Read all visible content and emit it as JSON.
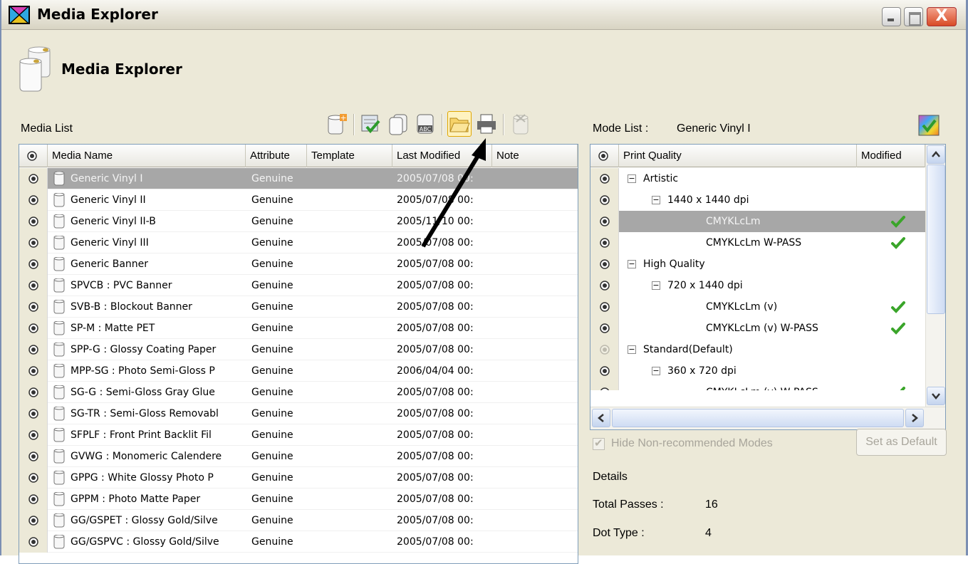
{
  "window": {
    "title": "Media Explorer",
    "close_glyph": "X"
  },
  "header": {
    "title": "Media Explorer",
    "icon": "media-rolls-icon"
  },
  "media_list": {
    "label": "Media List",
    "columns": [
      "Media Name",
      "Attribute",
      "Template",
      "Last Modified",
      "Note"
    ],
    "rows": [
      {
        "name": "Generic Vinyl I",
        "attribute": "Genuine",
        "template": "",
        "last_modified": "2005/07/08 00:",
        "note": "",
        "selected": true
      },
      {
        "name": "Generic Vinyl II",
        "attribute": "Genuine",
        "template": "",
        "last_modified": "2005/07/08 00:",
        "note": ""
      },
      {
        "name": "Generic Vinyl II-B",
        "attribute": "Genuine",
        "template": "",
        "last_modified": "2005/11/10 00:",
        "note": ""
      },
      {
        "name": "Generic Vinyl III",
        "attribute": "Genuine",
        "template": "",
        "last_modified": "2005/07/08 00:",
        "note": ""
      },
      {
        "name": "Generic Banner",
        "attribute": "Genuine",
        "template": "",
        "last_modified": "2005/07/08 00:",
        "note": ""
      },
      {
        "name": "SPVCB : PVC Banner",
        "attribute": "Genuine",
        "template": "",
        "last_modified": "2005/07/08 00:",
        "note": ""
      },
      {
        "name": "SVB-B : Blockout Banner",
        "attribute": "Genuine",
        "template": "",
        "last_modified": "2005/07/08 00:",
        "note": ""
      },
      {
        "name": "SP-M : Matte PET",
        "attribute": "Genuine",
        "template": "",
        "last_modified": "2005/07/08 00:",
        "note": ""
      },
      {
        "name": "SPP-G : Glossy Coating Paper",
        "attribute": "Genuine",
        "template": "",
        "last_modified": "2005/07/08 00:",
        "note": ""
      },
      {
        "name": "MPP-SG : Photo Semi-Gloss P",
        "attribute": "Genuine",
        "template": "",
        "last_modified": "2006/04/04 00:",
        "note": ""
      },
      {
        "name": "SG-G : Semi-Gloss Gray Glue",
        "attribute": "Genuine",
        "template": "",
        "last_modified": "2005/07/08 00:",
        "note": ""
      },
      {
        "name": "SG-TR : Semi-Gloss Removabl",
        "attribute": "Genuine",
        "template": "",
        "last_modified": "2005/07/08 00:",
        "note": ""
      },
      {
        "name": "SFPLF : Front Print Backlit Fil",
        "attribute": "Genuine",
        "template": "",
        "last_modified": "2005/07/08 00:",
        "note": ""
      },
      {
        "name": "GVWG : Monomeric Calendere",
        "attribute": "Genuine",
        "template": "",
        "last_modified": "2005/07/08 00:",
        "note": ""
      },
      {
        "name": "GPPG : White Glossy Photo P",
        "attribute": "Genuine",
        "template": "",
        "last_modified": "2005/07/08 00:",
        "note": ""
      },
      {
        "name": "GPPM : Photo Matte Paper",
        "attribute": "Genuine",
        "template": "",
        "last_modified": "2005/07/08 00:",
        "note": ""
      },
      {
        "name": "GG/GSPET : Glossy Gold/Silve",
        "attribute": "Genuine",
        "template": "",
        "last_modified": "2005/07/08 00:",
        "note": ""
      },
      {
        "name": "GG/GSPVC : Glossy Gold/Silve",
        "attribute": "Genuine",
        "template": "",
        "last_modified": "2005/07/08 00:",
        "note": ""
      }
    ]
  },
  "toolbar": {
    "buttons": [
      "new-media-icon",
      "recommend-check-icon",
      "copy-media-icon",
      "rename-media-icon",
      "open-folder-icon",
      "printer-icon",
      "delete-media-icon"
    ]
  },
  "mode_list": {
    "label": "Mode List :",
    "media_name": "Generic Vinyl I",
    "columns": [
      "Print Quality",
      "Modified"
    ],
    "rows": [
      {
        "level": 0,
        "text": "Artistic",
        "expander": "−",
        "modified": false
      },
      {
        "level": 1,
        "text": "1440 x 1440 dpi",
        "expander": "−",
        "modified": false
      },
      {
        "level": 2,
        "text": "CMYKLcLm",
        "expander": "",
        "modified": true,
        "selected": true
      },
      {
        "level": 2,
        "text": "CMYKLcLm W-PASS",
        "expander": "",
        "modified": true
      },
      {
        "level": 0,
        "text": "High Quality",
        "expander": "−",
        "modified": false
      },
      {
        "level": 1,
        "text": "720 x 1440 dpi",
        "expander": "−",
        "modified": false
      },
      {
        "level": 2,
        "text": "CMYKLcLm (v)",
        "expander": "",
        "modified": true
      },
      {
        "level": 2,
        "text": "CMYKLcLm (v) W-PASS",
        "expander": "",
        "modified": true
      },
      {
        "level": 0,
        "text": "Standard(Default)",
        "expander": "−",
        "modified": false,
        "eye_dim": true
      },
      {
        "level": 1,
        "text": "360 x 720 dpi",
        "expander": "−",
        "modified": false
      },
      {
        "level": 2,
        "text": "CMYKLcLm (v) W-PASS",
        "expander": "",
        "modified": true,
        "partial": true
      }
    ]
  },
  "options": {
    "hide_non_recommended_label": "Hide Non-recommended Modes",
    "hide_non_recommended_checked": true,
    "set_default_label": "Set as Default"
  },
  "details": {
    "title": "Details",
    "items": [
      {
        "label": "Total Passes :",
        "value": "16"
      },
      {
        "label": "Dot Type :",
        "value": "4"
      }
    ]
  },
  "colors": {
    "window_bg": "#ece9d8",
    "selected_row": "#a7a7a7",
    "check_green": "#3aa52a"
  }
}
